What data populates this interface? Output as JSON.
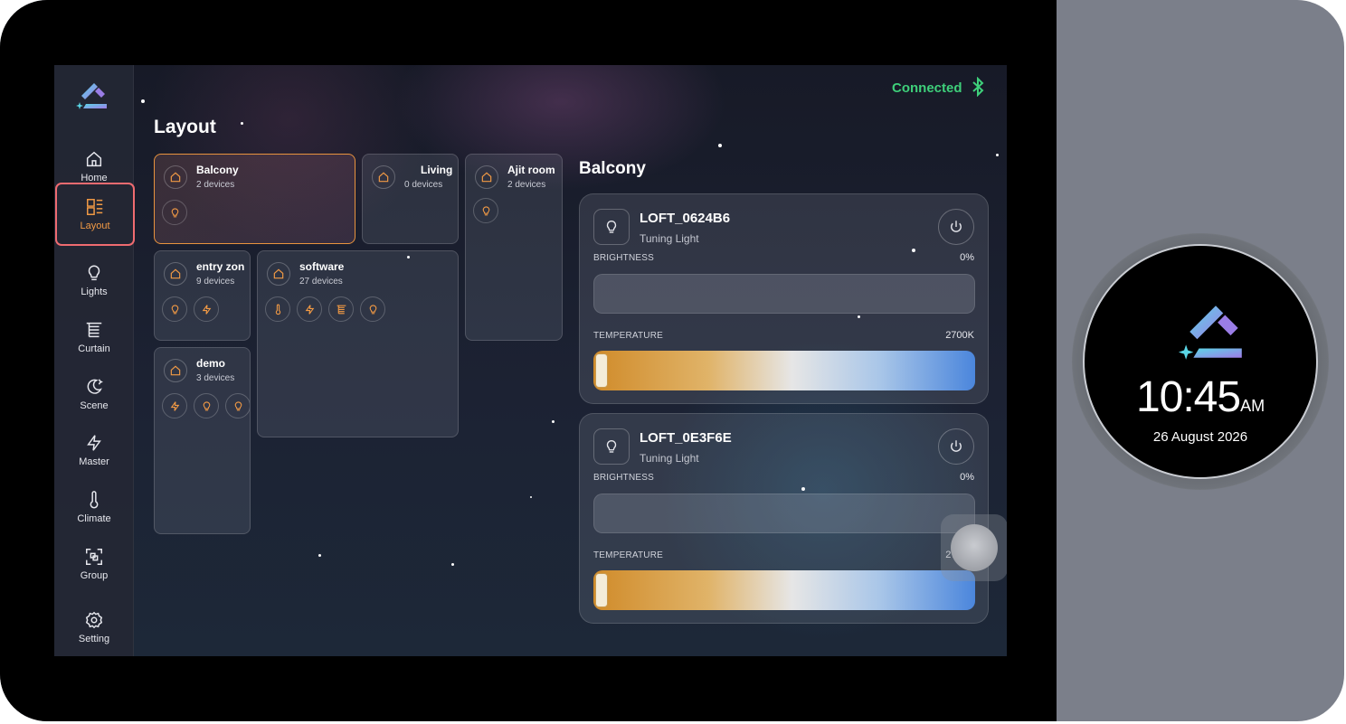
{
  "status": {
    "connection": "Connected"
  },
  "sidebar": {
    "items": [
      {
        "label": "Home",
        "icon": "home-icon"
      },
      {
        "label": "Layout",
        "icon": "layout-icon",
        "active": true
      },
      {
        "label": "Lights",
        "icon": "bulb-icon"
      },
      {
        "label": "Curtain",
        "icon": "curtain-icon"
      },
      {
        "label": "Scene",
        "icon": "moon-icon"
      },
      {
        "label": "Master",
        "icon": "lightning-icon"
      },
      {
        "label": "Climate",
        "icon": "thermometer-icon"
      },
      {
        "label": "Group",
        "icon": "group-icon"
      },
      {
        "label": "Setting",
        "icon": "gear-icon"
      }
    ]
  },
  "layout": {
    "title": "Layout",
    "rooms": [
      {
        "name": "Balcony",
        "count": "2 devices",
        "selected": true
      },
      {
        "name": "Living",
        "count": "0 devices"
      },
      {
        "name": "Ajit room",
        "count": "2 devices"
      },
      {
        "name": "entry zon",
        "count": "9 devices"
      },
      {
        "name": "software",
        "count": "27 devices"
      },
      {
        "name": "demo",
        "count": "3 devices"
      }
    ]
  },
  "detail": {
    "title": "Balcony",
    "devices": [
      {
        "name": "LOFT_0624B6",
        "type": "Tuning Light",
        "brightness_label": "BRIGHTNESS",
        "brightness_value": "0%",
        "temperature_label": "TEMPERATURE",
        "temperature_value": "2700K"
      },
      {
        "name": "LOFT_0E3F6E",
        "type": "Tuning Light",
        "brightness_label": "BRIGHTNESS",
        "brightness_value": "0%",
        "temperature_label": "TEMPERATURE",
        "temperature_value": "2700K"
      }
    ]
  },
  "dial": {
    "time": "10:45",
    "ampm": "AM",
    "date": "26 August 2026"
  },
  "colors": {
    "accent": "#f29a45",
    "connected": "#3ecf7a",
    "active_outline": "#ef6b70"
  }
}
